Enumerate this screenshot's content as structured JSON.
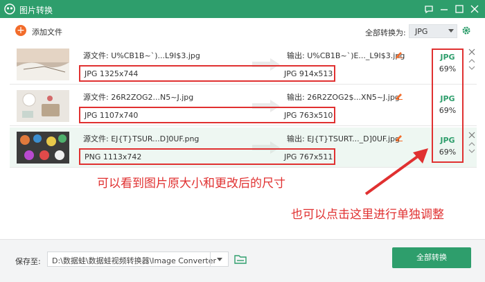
{
  "window": {
    "title": "图片转换"
  },
  "toolbar": {
    "add_label": "添加文件",
    "convert_to_label": "全部转换为:",
    "format_value": "JPG"
  },
  "rows": [
    {
      "source": "源文件:  U%CB1B~`)...L9I$3.jpg",
      "output": "输出:  U%CB1B~`)E..._L9I$3.jpg",
      "src_dims": "JPG  1325x744",
      "out_dims": "JPG  914x513",
      "format": "JPG",
      "quality": "69%"
    },
    {
      "source": "源文件:  26R2ZOG2...N5~J.jpg",
      "output": "输出:  26R2ZOG2$...XN5~J.jpg",
      "src_dims": "JPG  1107x740",
      "out_dims": "JPG  763x510",
      "format": "JPG",
      "quality": "69%"
    },
    {
      "source": "源文件:  EJ{T}TSUR...D]0UF.png",
      "output": "输出:  EJ{T}TSURT..._D]0UF.jpg",
      "src_dims": "PNG  1113x742",
      "out_dims": "JPG  767x511",
      "format": "JPG",
      "quality": "69%"
    }
  ],
  "annotations": {
    "dims_note": "可以看到图片原大小和更改后的尺寸",
    "single_adjust_note": "也可以点击这里进行单独调整"
  },
  "footer": {
    "save_label": "保存至:",
    "save_path": "D:\\数据蛙\\数据蛙视频转换器\\Image Converter",
    "convert_all_label": "全部转换"
  },
  "colors": {
    "brand": "#2e9e6c",
    "accent_add": "#f26c2b",
    "annotation": "#e03030"
  }
}
